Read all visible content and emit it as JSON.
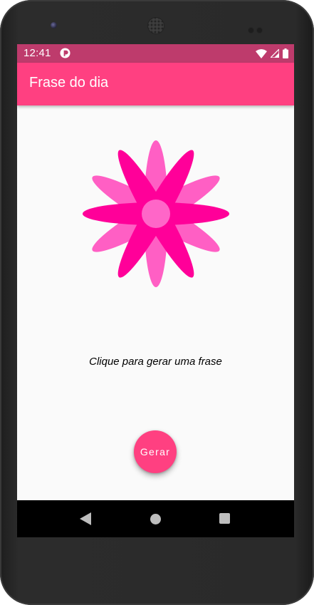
{
  "status_bar": {
    "time": "12:41",
    "icons": [
      "app-notification-icon",
      "wifi-icon",
      "cell-signal-icon",
      "battery-icon"
    ]
  },
  "app_bar": {
    "title": "Frase do dia"
  },
  "main": {
    "image": "flower-icon",
    "phrase": "Clique para gerar uma frase",
    "button_label": "Gerar"
  },
  "nav_bar": {
    "icons": [
      "back-icon",
      "home-icon",
      "recents-icon"
    ]
  },
  "colors": {
    "status_bar": "#be3b6c",
    "app_bar": "#ff4081",
    "fab": "#ff4081",
    "flower_dark": "#ff0099",
    "flower_light": "#ff5fc4",
    "flower_center": "#ff66c8",
    "background": "#fafafa"
  }
}
